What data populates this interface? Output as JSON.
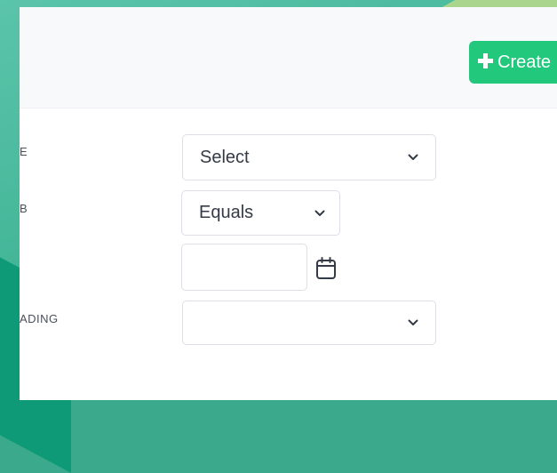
{
  "header": {
    "create_button_label": "Create"
  },
  "filters": [
    {
      "label": "E",
      "control": "select",
      "value": "Select"
    },
    {
      "label": "B",
      "control": "select",
      "value": "Equals"
    },
    {
      "label": "",
      "control": "date-input",
      "value": ""
    },
    {
      "label": "ADING",
      "control": "select",
      "value": ""
    }
  ],
  "icons": {
    "create_button": "plus-icon",
    "dropdown": "chevron-down-icon",
    "date_picker": "calendar-icon"
  },
  "colors": {
    "background": "#3fb394",
    "background_dark": "#0e9a77",
    "accent_strip": "#a9d58c",
    "create_button": "#22c97d",
    "panel": "#ffffff",
    "panel_header": "#f8f9fb",
    "field_border": "#dcdfe5",
    "text": "#343a46",
    "label_text": "#4a4f5a"
  }
}
